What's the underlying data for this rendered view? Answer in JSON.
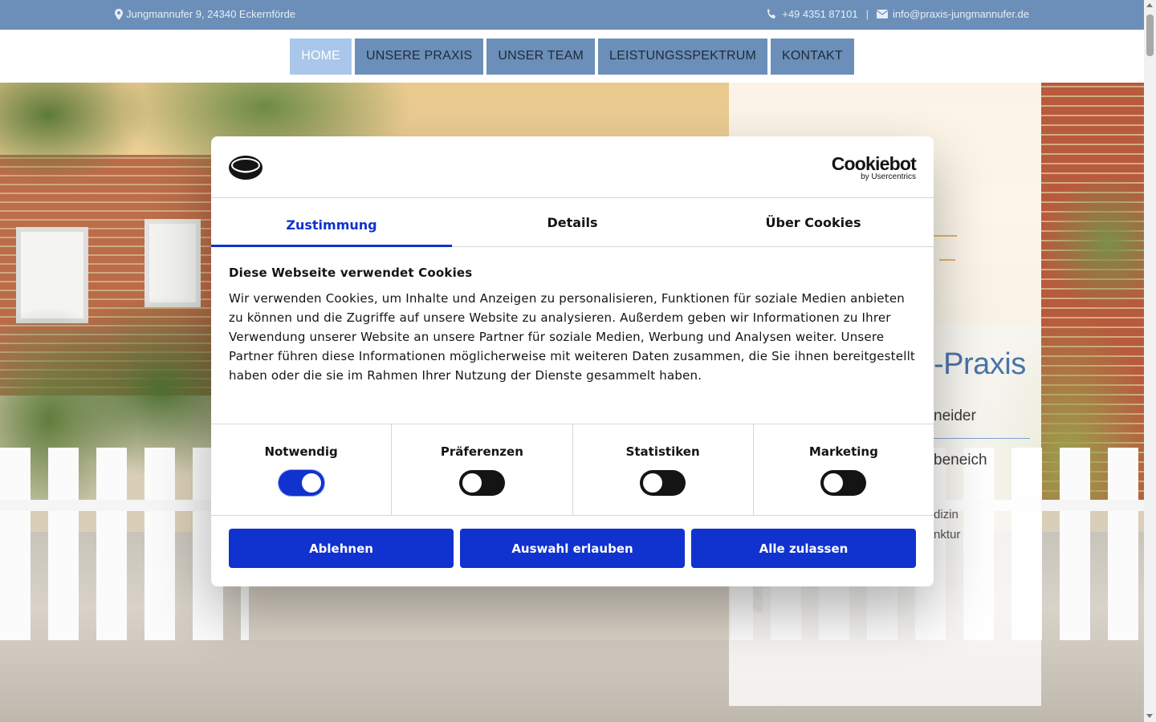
{
  "topbar": {
    "address": "Jungmannufer 9, 24340 Eckernförde",
    "phone": "+49 4351 87101",
    "separator": "|",
    "email": "info@praxis-jungmannufer.de",
    "background_color": "#6b8fb8"
  },
  "nav": {
    "items": [
      {
        "label": "HOME",
        "active": true
      },
      {
        "label": "UNSERE PRAXIS",
        "active": false
      },
      {
        "label": "UNSER TEAM",
        "active": false
      },
      {
        "label": "LEISTUNGSSPEKTRUM",
        "active": false
      },
      {
        "label": "KONTAKT",
        "active": false
      }
    ]
  },
  "hero": {
    "title_fragment": "-Praxis",
    "name1_fragment": "neider",
    "name2_fragment": "beneich",
    "spec1_fragment": "dizin",
    "spec2_fragment": "nktur"
  },
  "cookie": {
    "brand_name": "Cookiebot",
    "brand_sub": "by Usercentrics",
    "tabs": [
      {
        "label": "Zustimmung",
        "active": true
      },
      {
        "label": "Details",
        "active": false
      },
      {
        "label": "Über Cookies",
        "active": false
      }
    ],
    "heading": "Diese Webseite verwendet Cookies",
    "text": "Wir verwenden Cookies, um Inhalte und Anzeigen zu personalisieren, Funktionen für soziale Medien anbieten zu können und die Zugriffe auf unsere Website zu analysieren. Außerdem geben wir Informationen zu Ihrer Verwendung unserer Website an unsere Partner für soziale Medien, Werbung und Analysen weiter. Unsere Partner führen diese Informationen möglicherweise mit weiteren Daten zusammen, die Sie ihnen bereitgestellt haben oder die sie im Rahmen Ihrer Nutzung der Dienste gesammelt haben.",
    "categories": [
      {
        "label": "Notwendig",
        "checked": true
      },
      {
        "label": "Präferenzen",
        "checked": false
      },
      {
        "label": "Statistiken",
        "checked": false
      },
      {
        "label": "Marketing",
        "checked": false
      }
    ],
    "buttons": {
      "deny": "Ablehnen",
      "allow_selection": "Auswahl erlauben",
      "allow_all": "Alle zulassen"
    },
    "accent_color": "#1032cf"
  }
}
